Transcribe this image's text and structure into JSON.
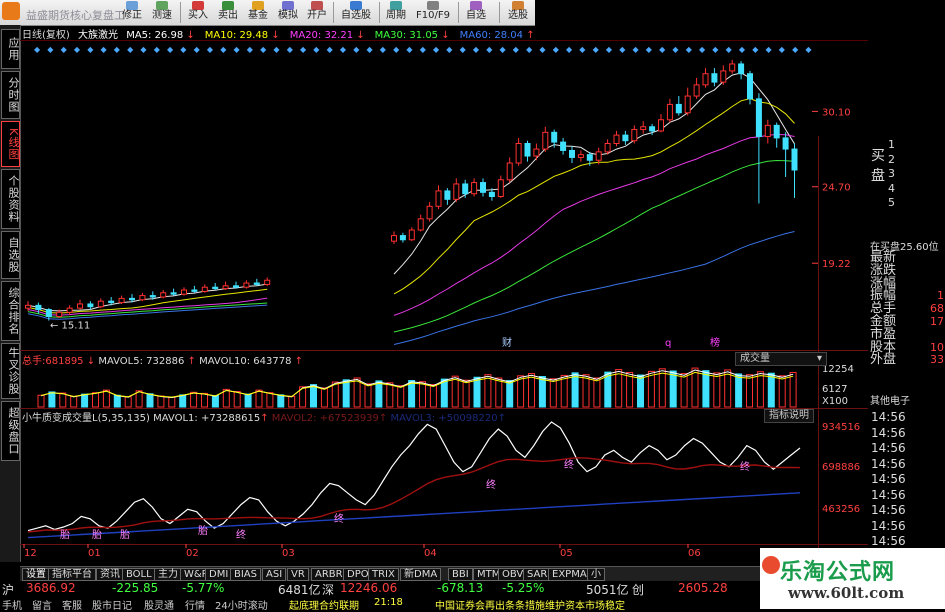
{
  "toolbar": {
    "title_blur": "益盛期货核心复盘工",
    "buttons": [
      "修正",
      "测速",
      "买入",
      "卖出",
      "基金",
      "模拟",
      "开户",
      "自选股",
      "周期",
      "F10/F9",
      "自选",
      "选股"
    ]
  },
  "left_tabs": [
    "应用",
    "分时图",
    "K线图",
    "个股资料",
    "自选股",
    "综合排名",
    "牛叉诊股",
    "超级盘口"
  ],
  "chart": {
    "period_label": "日线(复权)",
    "stock_name": "大族激光",
    "ma": [
      {
        "label": "MA5:",
        "value": "26.98",
        "arrow": "↓",
        "color": "#ffffff"
      },
      {
        "label": "MA10:",
        "value": "29.48",
        "arrow": "↓",
        "color": "#ffff00"
      },
      {
        "label": "MA20:",
        "value": "32.21",
        "arrow": "↓",
        "color": "#ff40ff"
      },
      {
        "label": "MA30:",
        "value": "31.05",
        "arrow": "↓",
        "color": "#40ff40"
      },
      {
        "label": "MA60:",
        "value": "28.04",
        "arrow": "↑",
        "color": "#4080ff"
      }
    ],
    "price_axis": [
      "30.10",
      "24.70",
      "19.22"
    ],
    "low_label": "← 15.11",
    "markers": [
      "财",
      "q",
      "榜"
    ],
    "volume": {
      "label": "总手:",
      "value": "681895",
      "mavol5": "MAVOL5: 732886",
      "mavol10": "MAVOL10: 643778",
      "dropdown": "成交量",
      "axis": [
        "12254",
        "6127",
        "X100"
      ]
    },
    "indicator": {
      "label": "小牛质变成交量L(5,35,135)",
      "mavol1": "MAVOL1: +73288615",
      "mavol2": "MAVOL2: +67523939",
      "mavol3": "MAVOL3: +50098220",
      "help": "指标说明",
      "axis": [
        "934516",
        "698886",
        "463256"
      ]
    },
    "x_axis": [
      "12",
      "01",
      "02",
      "03",
      "04",
      "05",
      "06"
    ],
    "pink_marks": [
      "胎",
      "胎",
      "胎",
      "胎",
      "终",
      "终",
      "终",
      "终",
      "终"
    ],
    "chart_data": {
      "type": "candlestick",
      "price_ticks": [
        30.1,
        24.7,
        19.22
      ],
      "low_marked": 15.11,
      "ma_values": {
        "MA5": 26.98,
        "MA10": 29.48,
        "MA20": 32.21,
        "MA30": 31.05,
        "MA60": 28.04
      },
      "volume_ticks": [
        12254,
        6127
      ],
      "indicator_ticks": [
        934516,
        698886,
        463256
      ],
      "candles": [
        {
          "o": 16.0,
          "c": 16.2,
          "h": 16.5,
          "l": 15.8
        },
        {
          "o": 16.2,
          "c": 15.9,
          "h": 16.4,
          "l": 15.6
        },
        {
          "o": 15.9,
          "c": 15.4,
          "h": 16.0,
          "l": 15.11
        },
        {
          "o": 15.4,
          "c": 15.7,
          "h": 15.9,
          "l": 15.3
        },
        {
          "o": 15.7,
          "c": 16.0,
          "h": 16.2,
          "l": 15.5
        },
        {
          "o": 16.0,
          "c": 16.3,
          "h": 16.6,
          "l": 15.9
        },
        {
          "o": 16.3,
          "c": 16.1,
          "h": 16.5,
          "l": 15.9
        },
        {
          "o": 16.1,
          "c": 16.5,
          "h": 16.7,
          "l": 16.0
        },
        {
          "o": 16.5,
          "c": 16.4,
          "h": 16.8,
          "l": 16.2
        },
        {
          "o": 16.4,
          "c": 16.7,
          "h": 16.9,
          "l": 16.3
        },
        {
          "o": 16.7,
          "c": 16.6,
          "h": 17.0,
          "l": 16.4
        },
        {
          "o": 16.6,
          "c": 16.9,
          "h": 17.1,
          "l": 16.5
        },
        {
          "o": 16.9,
          "c": 16.8,
          "h": 17.2,
          "l": 16.6
        },
        {
          "o": 16.8,
          "c": 17.1,
          "h": 17.3,
          "l": 16.7
        },
        {
          "o": 17.1,
          "c": 17.0,
          "h": 17.4,
          "l": 16.9
        },
        {
          "o": 17.0,
          "c": 17.3,
          "h": 17.5,
          "l": 16.9
        },
        {
          "o": 17.3,
          "c": 17.2,
          "h": 17.6,
          "l": 17.1
        },
        {
          "o": 17.2,
          "c": 17.5,
          "h": 17.7,
          "l": 17.1
        },
        {
          "o": 17.5,
          "c": 17.4,
          "h": 17.8,
          "l": 17.3
        },
        {
          "o": 17.4,
          "c": 17.6,
          "h": 17.9,
          "l": 17.3
        },
        {
          "o": 17.6,
          "c": 17.5,
          "h": 17.9,
          "l": 17.4
        },
        {
          "o": 17.5,
          "c": 17.8,
          "h": 18.0,
          "l": 17.4
        },
        {
          "o": 17.8,
          "c": 17.7,
          "h": 18.1,
          "l": 17.6
        },
        {
          "o": 17.7,
          "c": 18.0,
          "h": 18.2,
          "l": 17.6
        },
        {
          "o": 20.8,
          "c": 21.2,
          "h": 21.5,
          "l": 20.6
        },
        {
          "o": 21.2,
          "c": 20.9,
          "h": 21.4,
          "l": 20.7
        },
        {
          "o": 20.9,
          "c": 21.6,
          "h": 21.8,
          "l": 20.8
        },
        {
          "o": 21.6,
          "c": 22.4,
          "h": 22.7,
          "l": 21.5
        },
        {
          "o": 22.4,
          "c": 23.3,
          "h": 23.6,
          "l": 22.2
        },
        {
          "o": 23.3,
          "c": 24.4,
          "h": 24.8,
          "l": 23.1
        },
        {
          "o": 24.4,
          "c": 23.8,
          "h": 24.6,
          "l": 23.4
        },
        {
          "o": 23.8,
          "c": 24.9,
          "h": 25.3,
          "l": 23.6
        },
        {
          "o": 24.9,
          "c": 24.2,
          "h": 25.2,
          "l": 23.9
        },
        {
          "o": 24.2,
          "c": 25.0,
          "h": 25.3,
          "l": 24.0
        },
        {
          "o": 25.0,
          "c": 24.3,
          "h": 25.3,
          "l": 24.0
        },
        {
          "o": 24.3,
          "c": 24.0,
          "h": 24.6,
          "l": 23.7
        },
        {
          "o": 24.0,
          "c": 25.2,
          "h": 25.5,
          "l": 23.9
        },
        {
          "o": 25.2,
          "c": 26.4,
          "h": 26.8,
          "l": 25.0
        },
        {
          "o": 26.4,
          "c": 27.8,
          "h": 28.2,
          "l": 26.2
        },
        {
          "o": 27.8,
          "c": 26.9,
          "h": 28.0,
          "l": 26.5
        },
        {
          "o": 26.9,
          "c": 27.4,
          "h": 27.8,
          "l": 26.6
        },
        {
          "o": 27.4,
          "c": 28.6,
          "h": 29.0,
          "l": 27.2
        },
        {
          "o": 28.6,
          "c": 27.9,
          "h": 28.8,
          "l": 27.5
        },
        {
          "o": 27.9,
          "c": 27.3,
          "h": 28.2,
          "l": 27.0
        },
        {
          "o": 27.3,
          "c": 26.8,
          "h": 27.6,
          "l": 26.4
        },
        {
          "o": 26.8,
          "c": 27.0,
          "h": 27.3,
          "l": 26.5
        },
        {
          "o": 27.0,
          "c": 26.6,
          "h": 27.2,
          "l": 26.2
        },
        {
          "o": 26.6,
          "c": 27.2,
          "h": 27.5,
          "l": 26.3
        },
        {
          "o": 27.2,
          "c": 27.8,
          "h": 28.1,
          "l": 27.0
        },
        {
          "o": 27.8,
          "c": 28.4,
          "h": 28.7,
          "l": 27.6
        },
        {
          "o": 28.4,
          "c": 28.0,
          "h": 28.7,
          "l": 27.7
        },
        {
          "o": 28.0,
          "c": 28.8,
          "h": 29.1,
          "l": 27.8
        },
        {
          "o": 28.8,
          "c": 29.0,
          "h": 29.4,
          "l": 28.5
        },
        {
          "o": 29.0,
          "c": 28.7,
          "h": 29.2,
          "l": 28.4
        },
        {
          "o": 28.7,
          "c": 29.5,
          "h": 29.9,
          "l": 28.6
        },
        {
          "o": 29.5,
          "c": 30.6,
          "h": 31.0,
          "l": 29.3
        },
        {
          "o": 30.6,
          "c": 30.0,
          "h": 31.2,
          "l": 29.8
        },
        {
          "o": 30.0,
          "c": 31.2,
          "h": 31.8,
          "l": 29.8
        },
        {
          "o": 31.2,
          "c": 32.0,
          "h": 32.5,
          "l": 31.0
        },
        {
          "o": 32.0,
          "c": 32.8,
          "h": 33.2,
          "l": 31.8
        },
        {
          "o": 32.8,
          "c": 32.2,
          "h": 33.2,
          "l": 31.9
        },
        {
          "o": 32.2,
          "c": 33.0,
          "h": 33.4,
          "l": 32.0
        },
        {
          "o": 33.0,
          "c": 33.5,
          "h": 33.8,
          "l": 32.8
        },
        {
          "o": 33.5,
          "c": 32.8,
          "h": 33.7,
          "l": 32.4
        },
        {
          "o": 32.8,
          "c": 31.0,
          "h": 33.0,
          "l": 30.6
        },
        {
          "o": 31.0,
          "c": 28.3,
          "h": 31.4,
          "l": 23.5
        },
        {
          "o": 28.3,
          "c": 29.1,
          "h": 29.5,
          "l": 27.8
        },
        {
          "o": 29.1,
          "c": 28.2,
          "h": 29.3,
          "l": 27.5
        },
        {
          "o": 28.2,
          "c": 27.4,
          "h": 28.6,
          "l": 25.4
        },
        {
          "o": 27.4,
          "c": 25.9,
          "h": 27.8,
          "l": 23.9
        }
      ],
      "volume_bars": [
        3.2,
        4.1,
        3.8,
        2.9,
        3.5,
        3.9,
        4.6,
        3.2,
        2.8,
        4.4,
        3.6,
        3.0,
        2.7,
        3.3,
        4.0,
        3.7,
        3.1,
        4.8,
        4.2,
        3.5,
        4.6,
        3.9,
        3.3,
        2.9,
        5.5,
        6.1,
        5.2,
        6.8,
        7.4,
        7.9,
        6.3,
        7.1,
        6.6,
        5.8,
        7.2,
        6.9,
        6.1,
        7.6,
        8.4,
        7.3,
        8.1,
        8.8,
        7.9,
        7.2,
        8.5,
        9.1,
        8.3,
        7.7,
        8.6,
        9.3,
        8.8,
        7.9,
        9.5,
        10.2,
        9.4,
        8.7,
        9.7,
        10.4,
        9.8,
        9.1,
        10.6,
        9.9,
        9.3,
        10.1,
        9.0,
        8.8,
        9.6,
        9.2,
        8.5,
        9.4
      ],
      "indicator_series": [
        0.08,
        0.1,
        0.12,
        0.09,
        0.11,
        0.14,
        0.2,
        0.18,
        0.12,
        0.1,
        0.16,
        0.24,
        0.32,
        0.35,
        0.28,
        0.18,
        0.14,
        0.2,
        0.26,
        0.24,
        0.16,
        0.1,
        0.14,
        0.22,
        0.3,
        0.36,
        0.34,
        0.24,
        0.16,
        0.12,
        0.16,
        0.22,
        0.3,
        0.4,
        0.48,
        0.46,
        0.4,
        0.34,
        0.3,
        0.38,
        0.5,
        0.62,
        0.72,
        0.8,
        0.9,
        0.98,
        0.94,
        0.8,
        0.66,
        0.58,
        0.62,
        0.74,
        0.86,
        0.94,
        0.88,
        0.76,
        0.7,
        0.8,
        0.92,
        1.0,
        0.95,
        0.82,
        0.66,
        0.58,
        0.62,
        0.72,
        0.76,
        0.7,
        0.66,
        0.74,
        0.8,
        0.76,
        0.68,
        0.72,
        0.8,
        0.86,
        0.82,
        0.74,
        0.66,
        0.62,
        0.7,
        0.8,
        0.76,
        0.66,
        0.6,
        0.66,
        0.72,
        0.78
      ]
    }
  },
  "right_panel": {
    "buy_label": "买盘",
    "buy_rows": [
      "1",
      "2",
      "3",
      "4",
      "5"
    ],
    "buy_prefix": "在买盘25.60位",
    "fields": [
      "最新",
      "涨跌",
      "涨幅",
      "振幅",
      "总手",
      "金额",
      "市盈",
      "股本",
      "外盘"
    ],
    "values": [
      "",
      "",
      "",
      "1",
      "68",
      "17",
      "",
      "10",
      "33"
    ],
    "sector": "其他电子",
    "times": [
      "14:56",
      "14:56",
      "14:56",
      "14:56",
      "14:56",
      "14:56",
      "14:56",
      "14:56",
      "14:56",
      "14:57"
    ]
  },
  "bottom_tabs": [
    "设置",
    "指标平台",
    "资讯",
    "BOLL",
    "主力",
    "W&R",
    "DMI",
    "BIAS",
    "ASI",
    "VR",
    "ARBR",
    "DPO",
    "TRIX",
    "新DMA",
    "BBI",
    "MTM",
    "OBV",
    "SAR",
    "EXPMA",
    "小"
  ],
  "ticker": {
    "sh_label": "沪",
    "sh_value": "3686.92",
    "sh_change": "-225.85",
    "sh_pct": "-5.77%",
    "sh_vol": "6481亿",
    "sz_label": "深",
    "sz_value": "12246.06",
    "sz_change": "-678.13",
    "sz_pct": "-5.25%",
    "sz_vol": "5051亿",
    "cy_label": "创",
    "cy_value": "2605.28"
  },
  "ticker2": [
    "手机",
    "留言",
    "客服",
    "股市日记",
    "股灵通",
    "行情",
    "24小时滚动",
    "起底理合约联期",
    "21:18",
    "中国证券会再出条条措施维护资本市场稳定"
  ],
  "watermark": {
    "line1": "乐淘公式网",
    "line2": "www.60lt.com"
  }
}
